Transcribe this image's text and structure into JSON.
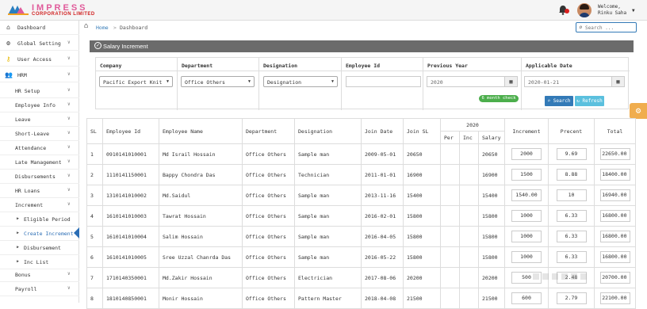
{
  "brand": {
    "name": "IMPRESS",
    "subtitle": "CORPORATION LIMITED"
  },
  "user": {
    "welcome": "Welcome,",
    "name": "Rinku Saha"
  },
  "sidebar": [
    {
      "label": "Dashboard",
      "icon": "dashboard-icon"
    },
    {
      "label": "Global Setting",
      "icon": "gear-icon"
    },
    {
      "label": "User Access",
      "icon": "key-icon"
    },
    {
      "label": "HRM",
      "icon": "users-icon"
    },
    {
      "label": "HR Setup"
    },
    {
      "label": "Employee Info"
    },
    {
      "label": "Leave"
    },
    {
      "label": "Short-Leave"
    },
    {
      "label": "Attendance"
    },
    {
      "label": "Late Management"
    },
    {
      "label": "Disbursements"
    },
    {
      "label": "HR Loans"
    },
    {
      "label": "Increment"
    },
    {
      "label": "Eligible Period"
    },
    {
      "label": "Create Increment"
    },
    {
      "label": "Disbursement"
    },
    {
      "label": "Inc List"
    },
    {
      "label": "Bonus"
    },
    {
      "label": "Payroll"
    }
  ],
  "breadcrumb": {
    "home": "Home",
    "sep": ">",
    "current": "Dashboard"
  },
  "search": {
    "placeholder": "Search ..."
  },
  "panel": {
    "title": "Salary Increment"
  },
  "filters": {
    "company": {
      "label": "Company",
      "value": "Pacific Export Knit"
    },
    "department": {
      "label": "Department",
      "value": "Office Others"
    },
    "designation": {
      "label": "Designation",
      "value": "Designation"
    },
    "employee_id": {
      "label": "Employee Id",
      "value": ""
    },
    "previous_year": {
      "label": "Previous Year",
      "value": "2020"
    },
    "applicable_date": {
      "label": "Applicable Date",
      "value": "2020-01-21"
    }
  },
  "buttons": {
    "month_check": "6 month check",
    "search": "Search",
    "refresh": "Refresh"
  },
  "table": {
    "headers": {
      "sl": "SL",
      "emp_id": "Employee Id",
      "emp_name": "Employee Name",
      "dept": "Department",
      "desig": "Designation",
      "join_date": "Join Date",
      "join_sl": "Join SL",
      "year": "2020",
      "per": "Per",
      "inc": "Inc",
      "salary": "Salary",
      "increment": "Increment",
      "percent": "Precent",
      "total": "Total"
    },
    "rows": [
      {
        "sl": "1",
        "id": "0910141010001",
        "name": "Md Israil Hossain",
        "dept": "Office Others",
        "desig": "Sample man",
        "join": "2009-05-01",
        "jsl": "20650",
        "salary": "20650",
        "inc": "2000",
        "pct": "9.69",
        "total": "22650.00"
      },
      {
        "sl": "2",
        "id": "1110141150001",
        "name": "Bappy Chondra Das",
        "dept": "Office Others",
        "desig": "Technician",
        "join": "2011-01-01",
        "jsl": "16900",
        "salary": "16900",
        "inc": "1500",
        "pct": "8.88",
        "total": "18400.00"
      },
      {
        "sl": "3",
        "id": "1310141010002",
        "name": "Md.Saidul",
        "dept": "Office Others",
        "desig": "Sample man",
        "join": "2013-11-16",
        "jsl": "15400",
        "salary": "15400",
        "inc": "1540.00",
        "pct": "10",
        "total": "16940.00"
      },
      {
        "sl": "4",
        "id": "1610141010003",
        "name": "Tawrat Hossain",
        "dept": "Office Others",
        "desig": "Sample man",
        "join": "2016-02-01",
        "jsl": "15800",
        "salary": "15800",
        "inc": "1000",
        "pct": "6.33",
        "total": "16800.00"
      },
      {
        "sl": "5",
        "id": "1610141010004",
        "name": "Salim Hossain",
        "dept": "Office Others",
        "desig": "Sample man",
        "join": "2016-04-05",
        "jsl": "15800",
        "salary": "15800",
        "inc": "1000",
        "pct": "6.33",
        "total": "16800.00"
      },
      {
        "sl": "6",
        "id": "1610141010005",
        "name": "Sree Uzzal Chanrda Das",
        "dept": "Office Others",
        "desig": "Sample man",
        "join": "2016-05-22",
        "jsl": "15800",
        "salary": "15800",
        "inc": "1000",
        "pct": "6.33",
        "total": "16800.00"
      },
      {
        "sl": "7",
        "id": "1710140350001",
        "name": "Md.Zakir Hossain",
        "dept": "Office Others",
        "desig": "Electrician",
        "join": "2017-08-06",
        "jsl": "20200",
        "salary": "20200",
        "inc": "500",
        "pct": "2.48",
        "total": "20700.00"
      },
      {
        "sl": "8",
        "id": "1810140850001",
        "name": "Monir Hossain",
        "dept": "Office Others",
        "desig": "Pattern Master",
        "join": "2018-04-08",
        "jsl": "21500",
        "salary": "21500",
        "inc": "600",
        "pct": "2.79",
        "total": "22100.00"
      }
    ]
  }
}
